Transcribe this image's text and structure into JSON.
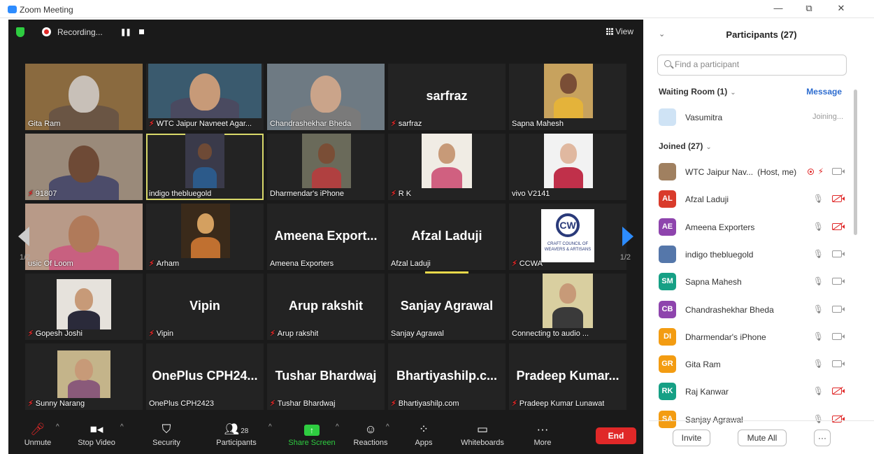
{
  "window": {
    "title": "Zoom Meeting",
    "minimize": "—",
    "restore": "⧉",
    "close": "✕"
  },
  "topbar": {
    "recording_label": "Recording...",
    "view_label": "View"
  },
  "tiles": [
    {
      "name": "Gita Ram",
      "muted": false,
      "big": ""
    },
    {
      "name": "WTC Jaipur Navneet Agar...",
      "muted": true,
      "big": ""
    },
    {
      "name": "Chandrashekhar Bheda",
      "muted": false,
      "big": ""
    },
    {
      "name": "sarfraz",
      "muted": true,
      "big": "sarfraz"
    },
    {
      "name": "Sapna Mahesh",
      "muted": false,
      "big": ""
    },
    {
      "name": "91807",
      "muted": true,
      "big": ""
    },
    {
      "name": "indigo thebluegold",
      "muted": false,
      "big": ""
    },
    {
      "name": "Dharmendar's iPhone",
      "muted": false,
      "big": ""
    },
    {
      "name": "R K",
      "muted": true,
      "big": ""
    },
    {
      "name": "vivo V2141",
      "muted": false,
      "big": ""
    },
    {
      "name": "usic Of Loom",
      "muted": false,
      "big": ""
    },
    {
      "name": "Arham",
      "muted": true,
      "big": ""
    },
    {
      "name": "Ameena Exporters",
      "muted": false,
      "big": "Ameena  Export..."
    },
    {
      "name": "Afzal Laduji",
      "muted": false,
      "big": "Afzal Laduji"
    },
    {
      "name": "CCWA",
      "muted": true,
      "big": ""
    },
    {
      "name": "Gopesh Joshi",
      "muted": true,
      "big": ""
    },
    {
      "name": "Vipin",
      "muted": true,
      "big": "Vipin"
    },
    {
      "name": "Arup rakshit",
      "muted": true,
      "big": "Arup rakshit"
    },
    {
      "name": "Sanjay Agrawal",
      "muted": false,
      "big": "Sanjay Agrawal"
    },
    {
      "name": "Connecting to audio ...",
      "muted": false,
      "big": ""
    },
    {
      "name": "Sunny Narang",
      "muted": true,
      "big": ""
    },
    {
      "name": "OnePlus CPH2423",
      "muted": false,
      "big": "OnePlus  CPH24..."
    },
    {
      "name": "Tushar Bhardwaj",
      "muted": true,
      "big": "Tushar Bhardwaj"
    },
    {
      "name": "Bhartiyashilp.com",
      "muted": true,
      "big": "Bhartiyashilp.c..."
    },
    {
      "name": "Pradeep Kumar Lunawat",
      "muted": true,
      "big": "Pradeep  Kumar..."
    }
  ],
  "pager": {
    "left": "1/2",
    "right": "1/2"
  },
  "ccwa_logo_text": "CRAFT COUNCIL OF WEAVERS & ARTISANS",
  "toolbar": {
    "unmute": "Unmute",
    "stop_video": "Stop Video",
    "security": "Security",
    "participants": "Participants",
    "participants_count": "28",
    "share_screen": "Share Screen",
    "reactions": "Reactions",
    "apps": "Apps",
    "whiteboards": "Whiteboards",
    "more": "More",
    "end": "End"
  },
  "panel": {
    "title": "Participants (27)",
    "search_placeholder": "Find a participant",
    "waiting_room": "Waiting Room (1)",
    "message": "Message",
    "waiting": [
      {
        "name": "Vasumitra",
        "status": "Joining..."
      }
    ],
    "joined": "Joined (27)",
    "participants": [
      {
        "initials": "",
        "name": "WTC Jaipur Nav...",
        "tag": "(Host, me)",
        "color": "#a08060",
        "mic": "off",
        "video": "on"
      },
      {
        "initials": "AL",
        "name": "Afzal Laduji",
        "tag": "",
        "color": "#d93b2b",
        "mic": "on",
        "video": "off"
      },
      {
        "initials": "AE",
        "name": "Ameena Exporters",
        "tag": "",
        "color": "#8e44ad",
        "mic": "on",
        "video": "off"
      },
      {
        "initials": "",
        "name": "indigo thebluegold",
        "tag": "",
        "color": "#5577aa",
        "mic": "on",
        "video": "on"
      },
      {
        "initials": "SM",
        "name": "Sapna Mahesh",
        "tag": "",
        "color": "#16a085",
        "mic": "on",
        "video": "on"
      },
      {
        "initials": "CB",
        "name": "Chandrashekhar Bheda",
        "tag": "",
        "color": "#8e44ad",
        "mic": "on",
        "video": "on"
      },
      {
        "initials": "DI",
        "name": "Dharmendar's iPhone",
        "tag": "",
        "color": "#f39c12",
        "mic": "on",
        "video": "on"
      },
      {
        "initials": "GR",
        "name": "Gita Ram",
        "tag": "",
        "color": "#f39c12",
        "mic": "on",
        "video": "on"
      },
      {
        "initials": "RK",
        "name": "Raj Kanwar",
        "tag": "",
        "color": "#16a085",
        "mic": "on",
        "video": "off"
      },
      {
        "initials": "SA",
        "name": "Sanjay Agrawal",
        "tag": "",
        "color": "#f39c12",
        "mic": "on",
        "video": "off"
      }
    ],
    "invite": "Invite",
    "mute_all": "Mute All",
    "more": "···"
  },
  "colors": {
    "accent": "#2D8CFF",
    "end": "#e02828",
    "speaker": "#d9d96a",
    "mic_off": "#e02828",
    "green": "#2ecc40"
  }
}
